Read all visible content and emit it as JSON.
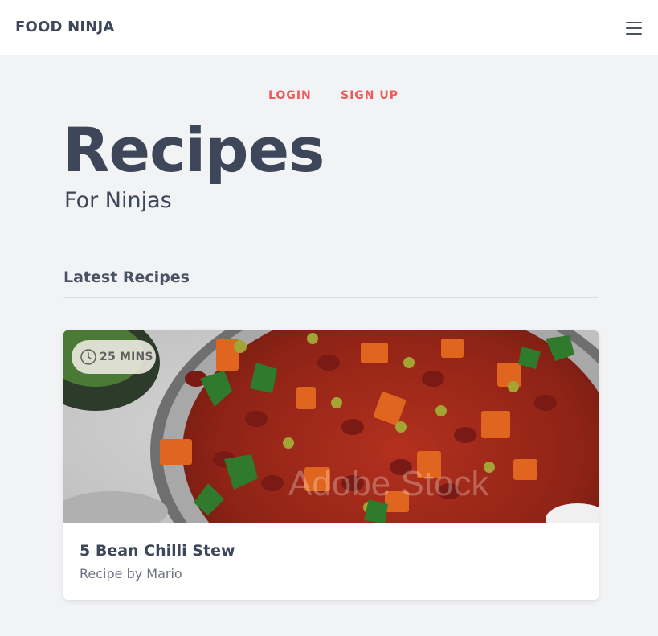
{
  "header": {
    "brand": "FOOD NINJA",
    "menu_icon": "hamburger-menu-icon"
  },
  "nav": {
    "login": "LOGIN",
    "signup": "SIGN UP",
    "link_color": "#ef5a5a"
  },
  "hero": {
    "title": "Recipes",
    "subtitle": "For Ninjas"
  },
  "section": {
    "title": "Latest Recipes"
  },
  "recipes": [
    {
      "time": "25 MINS",
      "time_icon": "clock-icon",
      "title": "5 Bean Chilli Stew",
      "author": "Recipe by Mario",
      "watermark": "Adobe Stock"
    }
  ]
}
